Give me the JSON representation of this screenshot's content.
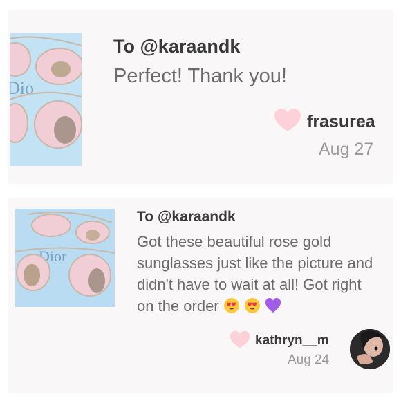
{
  "comments": [
    {
      "to": "To @karaandk",
      "message": "Perfect! Thank you!",
      "username": "frasurea",
      "date": "Aug 27",
      "thumbnail_text": "Dio",
      "icons": [
        "heart-icon"
      ]
    },
    {
      "to": "To @karaandk",
      "message": "Got these beautiful rose gold sunglasses just like the picture and didn't have to wait at all! Got right on the order",
      "emojis": [
        "heart-eyes-emoji",
        "heart-eyes-emoji",
        "purple-heart-emoji"
      ],
      "username": "kathryn__m",
      "date": "Aug 24",
      "thumbnail_text": "Dior",
      "icons": [
        "heart-icon"
      ]
    }
  ],
  "colors": {
    "heart": "#fcd2d8",
    "card_bg": "#faf7f8",
    "thumb_bg": "#b9dcf2",
    "lens": "#f1cdd6",
    "purple_heart": "#a25ce6",
    "emoji_yellow": "#ffc83a"
  }
}
